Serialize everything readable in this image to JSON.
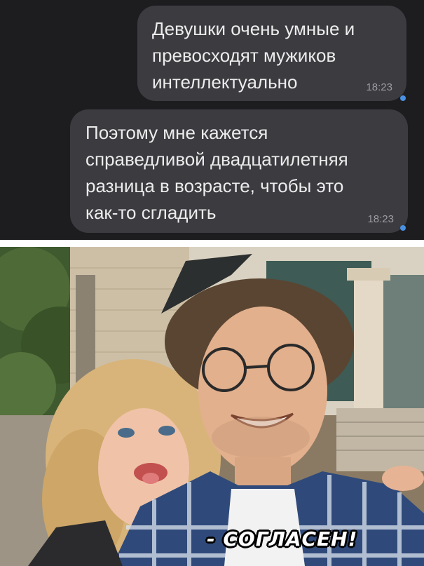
{
  "chat": {
    "messages": [
      {
        "text": "Девушки очень умные и\nпревосходят мужиков\nинтеллектуально",
        "time": "18:23"
      },
      {
        "text": "Поэтому мне кажется\nсправедливой двадцатилетняя\nразница в возрасте, чтобы это\nкак-то сгладить",
        "time": "18:23"
      }
    ]
  },
  "photo": {
    "caption": "- СОГЛАСЕН!"
  },
  "colors": {
    "chat_background": "#1d1d20",
    "bubble": "#3b3b40",
    "bubble_text": "#ececec",
    "read_indicator": "#4a90e2"
  }
}
